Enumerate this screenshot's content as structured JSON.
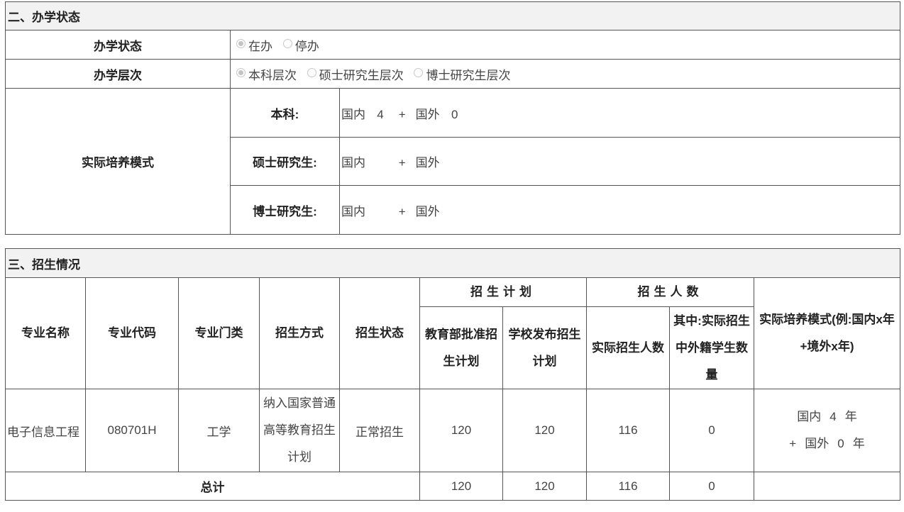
{
  "section2": {
    "title": "二、办学状态",
    "status": {
      "label": "办学状态",
      "options": [
        "在办",
        "停办"
      ]
    },
    "level": {
      "label": "办学层次",
      "options": [
        "本科层次",
        "硕士研究生层次",
        "博士研究生层次"
      ]
    },
    "mode": {
      "label": "实际培养模式",
      "rows": [
        {
          "label": "本科:",
          "domestic": "国内",
          "domestic_value": "4",
          "plus": "+",
          "foreign": "国外",
          "foreign_value": "0"
        },
        {
          "label": "硕士研究生:",
          "domestic": "国内",
          "domestic_value": "",
          "plus": "+",
          "foreign": "国外",
          "foreign_value": ""
        },
        {
          "label": "博士研究生:",
          "domestic": "国内",
          "domestic_value": "",
          "plus": "+",
          "foreign": "国外",
          "foreign_value": ""
        }
      ]
    }
  },
  "section3": {
    "title": "三、招生情况",
    "headers": {
      "major_name": "专业名称",
      "major_code": "专业代码",
      "major_category": "专业门类",
      "enroll_method": "招生方式",
      "enroll_status": "招生状态",
      "plan_group": "招生计划",
      "plan_ministry": "教育部批准招生计划",
      "plan_school": "学校发布招生计划",
      "count_group": "招生人数",
      "count_actual": "实际招生人数",
      "count_foreign": "其中:实际招生中外籍学生数量",
      "model": "实际培养模式(例:国内x年+境外x年)"
    },
    "row": {
      "major_name": "电子信息工程",
      "major_code": "080701H",
      "major_category": "工学",
      "enroll_method": "纳入国家普通高等教育招生计划",
      "enroll_status": "正常招生",
      "plan_ministry": "120",
      "plan_school": "120",
      "count_actual": "116",
      "count_foreign": "0",
      "model_domestic": "国内",
      "model_domestic_value": "4",
      "model_year": "年",
      "model_plus": "+",
      "model_foreign": "国外",
      "model_foreign_value": "0"
    },
    "total": {
      "label": "总计",
      "plan_ministry": "120",
      "plan_school": "120",
      "count_actual": "116",
      "count_foreign": "0"
    }
  }
}
